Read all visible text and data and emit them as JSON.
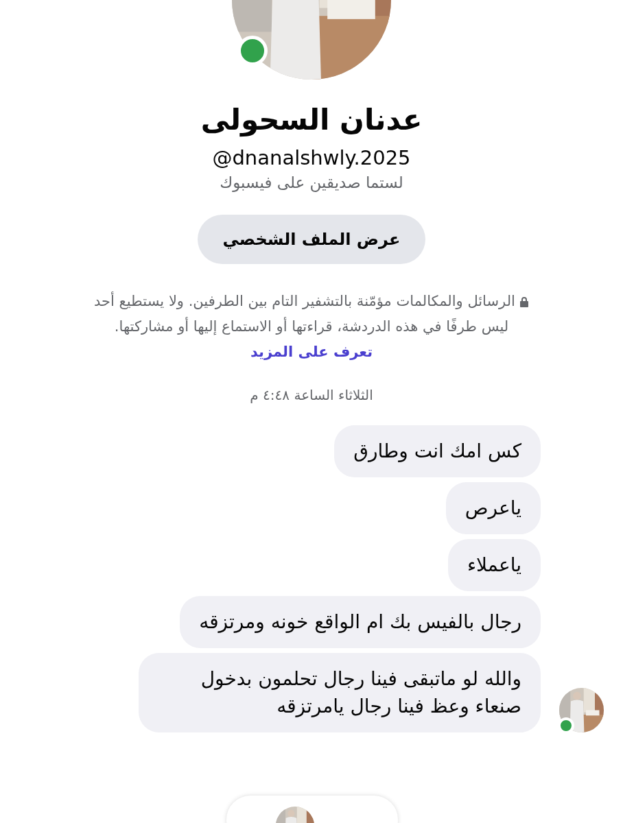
{
  "profile": {
    "name": "عدنان السحولى",
    "handle": "@dnanalshwly.2025",
    "relation": "لستما صديقين على فيسبوك",
    "online": true,
    "view_profile_button": "عرض الملف الشخصي"
  },
  "encryption_notice": {
    "text": "الرسائل والمكالمات مؤمّنة بالتشفير التام بين الطرفين. ولا يستطيع أحد ليس طرفًا في هذه الدردشة، قراءتها أو الاستماع إليها أو مشاركتها.",
    "link": "تعرف على المزيد"
  },
  "timestamp": "الثلاثاء الساعة ٤:٤٨ م",
  "messages": [
    {
      "text": "كس امك انت وطارق"
    },
    {
      "text": "ياعرص"
    },
    {
      "text": "ياعملاء"
    },
    {
      "text": "رجال بالفيس بك ام الواقع خونه ومرتزقه"
    },
    {
      "text": "والله لو ماتبقى فينا رجال تحلمون بدخول صنعاء وعظ فينا رجال يامرتزقه"
    }
  ],
  "sender": {
    "online": true
  }
}
